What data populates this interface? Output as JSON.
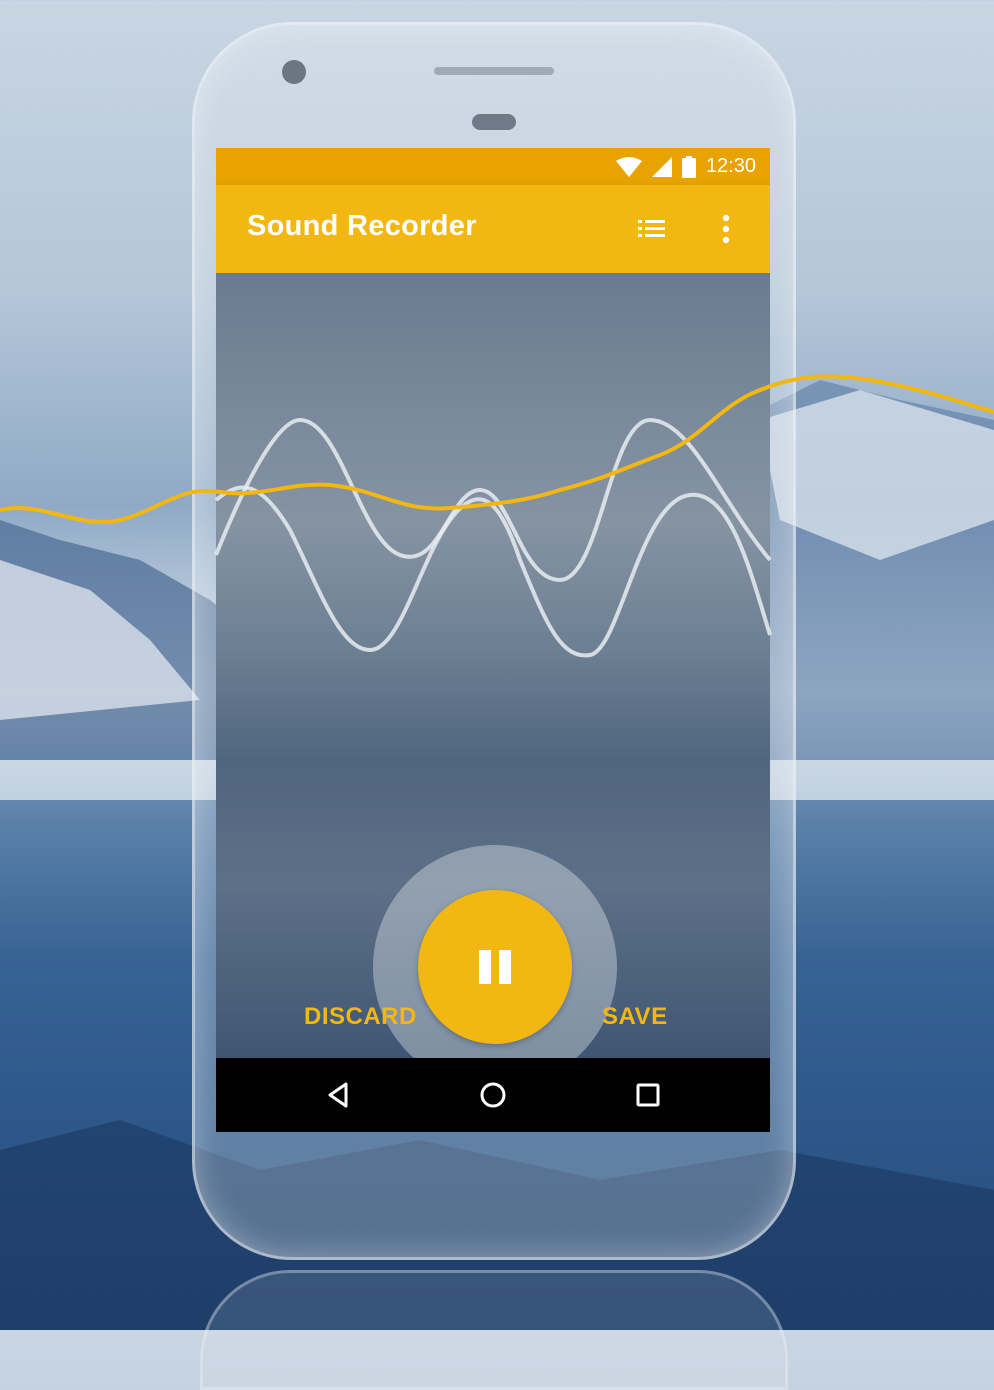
{
  "status_bar": {
    "time": "12:30",
    "icons": [
      "wifi-icon",
      "cellular-signal-icon",
      "battery-icon"
    ]
  },
  "app_bar": {
    "title": "Sound Recorder",
    "actions": [
      "list-icon",
      "more-vert-icon"
    ]
  },
  "controls": {
    "pause_icon": "pause-icon",
    "discard_label": "DISCARD",
    "save_label": "SAVE"
  },
  "nav_bar": {
    "buttons": [
      "back-icon",
      "home-icon",
      "recents-icon"
    ]
  },
  "colors": {
    "accent": "#f2b711",
    "status_bar": "#e8a300",
    "nav_bar": "#000000",
    "wave_white": "#e8ecf0"
  }
}
